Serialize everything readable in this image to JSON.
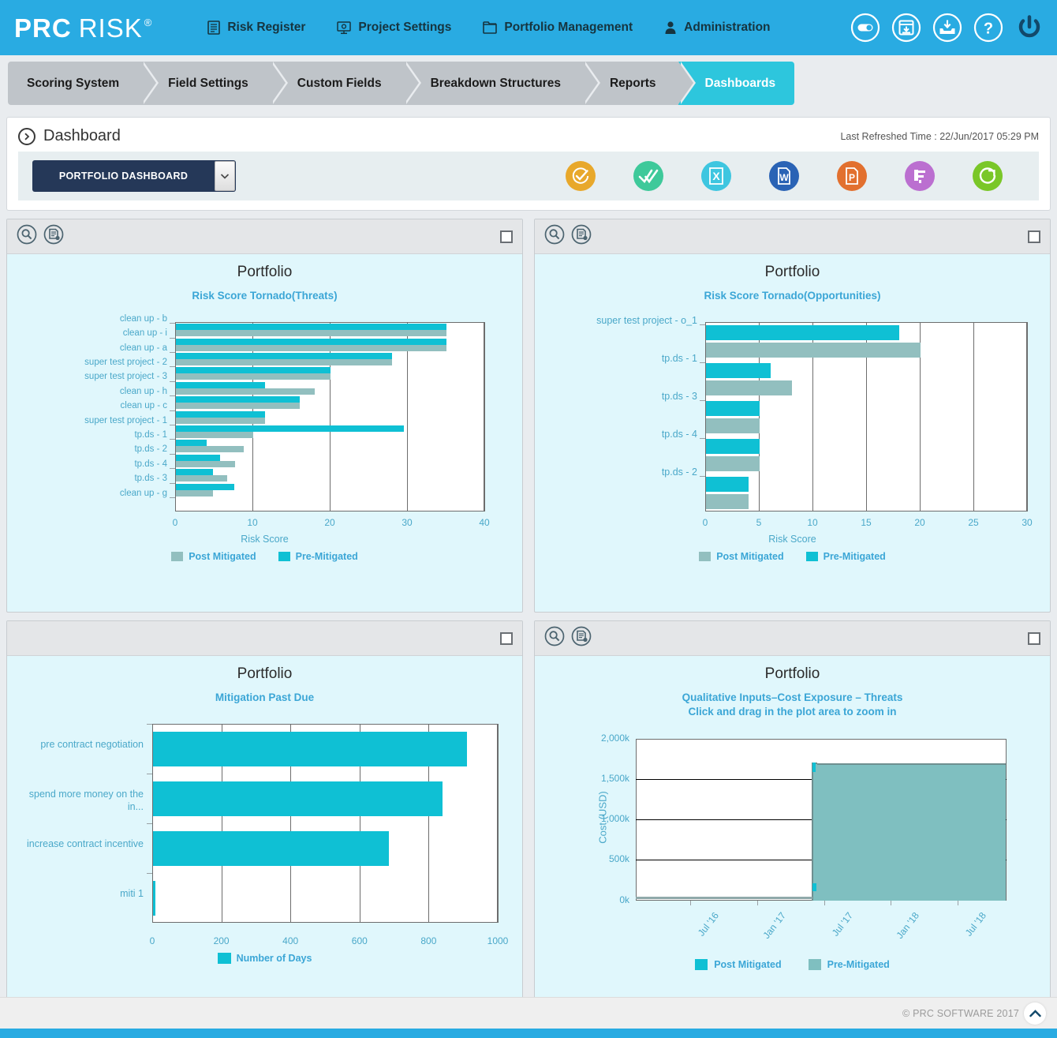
{
  "brand": {
    "part1": "PRC",
    "part2": "RISK",
    "registered": "®"
  },
  "nav": [
    {
      "label": "Risk Register",
      "icon": "document-list-icon"
    },
    {
      "label": "Project Settings",
      "icon": "project-settings-icon"
    },
    {
      "label": "Portfolio Management",
      "icon": "folder-icon"
    },
    {
      "label": "Administration",
      "icon": "user-icon"
    }
  ],
  "header_icons": [
    {
      "name": "toggle-icon",
      "title": "Toggle"
    },
    {
      "name": "calendar-window-icon",
      "title": "Window"
    },
    {
      "name": "inbox-download-icon",
      "title": "Download"
    },
    {
      "name": "help-icon",
      "title": "Help"
    },
    {
      "name": "power-icon",
      "title": "Log out"
    }
  ],
  "tabs": [
    {
      "label": "Scoring System",
      "active": false
    },
    {
      "label": "Field Settings",
      "active": false
    },
    {
      "label": "Custom Fields",
      "active": false
    },
    {
      "label": "Breakdown Structures",
      "active": false
    },
    {
      "label": "Reports",
      "active": false
    },
    {
      "label": "Dashboards",
      "active": true
    }
  ],
  "dashboard": {
    "title": "Dashboard",
    "refreshed_label": "Last Refreshed Time : 22/Jun/2017 05:29 PM",
    "selected_dashboard": "PORTFOLIO DASHBOARD",
    "export_icons": [
      {
        "name": "approve-check-icon",
        "color": "#e8a82b"
      },
      {
        "name": "double-check-icon",
        "color": "#3ec99a"
      },
      {
        "name": "excel-export-icon",
        "color": "#3ec6e0"
      },
      {
        "name": "word-export-icon",
        "color": "#2a63b5"
      },
      {
        "name": "powerpoint-export-icon",
        "color": "#e2702f"
      },
      {
        "name": "ms-project-export-icon",
        "color": "#bb6fd0"
      },
      {
        "name": "refresh-icon",
        "color": "#7ac728"
      }
    ]
  },
  "colors": {
    "accent": "#29abe2",
    "pre_mitigated": "#0fc0d4",
    "post_mitigated": "#92bfbf",
    "panel_bg": "#e0f7fc",
    "title": "#3ba6d6"
  },
  "panels": [
    {
      "name": "risk-score-tornado-threats",
      "has_tools": true,
      "tools": [
        "zoom-icon",
        "print-report-icon"
      ],
      "checkbox": false
    },
    {
      "name": "risk-score-tornado-opportunities",
      "has_tools": true,
      "tools": [
        "zoom-icon",
        "print-report-icon"
      ],
      "checkbox": false
    },
    {
      "name": "mitigation-past-due",
      "has_tools": false,
      "tools": [],
      "checkbox": false
    },
    {
      "name": "cost-exposure-threats",
      "has_tools": true,
      "tools": [
        "zoom-icon",
        "print-report-icon"
      ],
      "checkbox": false
    }
  ],
  "chart_data": [
    {
      "type": "bar",
      "orientation": "horizontal",
      "title": "Portfolio",
      "subtitle": "Risk Score Tornado(Threats)",
      "xlabel": "Risk Score",
      "ylabel": "",
      "xlim": [
        0,
        40
      ],
      "xticks": [
        0,
        10,
        20,
        30,
        40
      ],
      "grid": true,
      "legend": "bottom",
      "categories": [
        "clean up - b",
        "clean up - i",
        "clean up - a",
        "super test project - 2",
        "super test project - 3",
        "clean up - h",
        "clean up - c",
        "super test project - 1",
        "tp.ds - 1",
        "tp.ds - 2",
        "tp.ds - 4",
        "tp.ds - 3",
        "clean up - g"
      ],
      "series": [
        {
          "name": "Pre-Mitigated",
          "color": "#0fc0d4",
          "values": [
            35,
            35,
            28,
            20,
            11.5,
            16,
            11.5,
            29.5,
            4,
            5.7,
            4.8,
            7.6,
            0
          ]
        },
        {
          "name": "Post Mitigated",
          "color": "#92bfbf",
          "values": [
            35,
            35,
            28,
            20,
            18,
            16,
            11.5,
            10,
            8.8,
            7.7,
            6.6,
            4.8,
            0
          ]
        }
      ]
    },
    {
      "type": "bar",
      "orientation": "horizontal",
      "title": "Portfolio",
      "subtitle": "Risk Score Tornado(Opportunities)",
      "xlabel": "Risk Score",
      "ylabel": "",
      "xlim": [
        0,
        30
      ],
      "xticks": [
        0,
        5,
        10,
        15,
        20,
        25,
        30
      ],
      "grid": true,
      "legend": "bottom",
      "categories": [
        "super test project - o_1",
        "tp.ds - 1",
        "tp.ds - 3",
        "tp.ds - 4",
        "tp.ds - 2"
      ],
      "series": [
        {
          "name": "Pre-Mitigated",
          "color": "#0fc0d4",
          "values": [
            18,
            6,
            5,
            5,
            4
          ]
        },
        {
          "name": "Post Mitigated",
          "color": "#92bfbf",
          "values": [
            20,
            8,
            5,
            5,
            4
          ]
        }
      ]
    },
    {
      "type": "bar",
      "orientation": "horizontal",
      "title": "Portfolio",
      "subtitle": "Mitigation Past Due",
      "xlabel": "Number of Days",
      "ylabel": "",
      "xlim": [
        0,
        1000
      ],
      "xticks": [
        0,
        200,
        400,
        600,
        800,
        1000
      ],
      "grid": true,
      "legend": "bottom",
      "categories": [
        "pre contract negotiation",
        "spend more money on the in...",
        "increase contract incentive",
        "miti 1"
      ],
      "series": [
        {
          "name": "Number of Days",
          "color": "#0fc0d4",
          "values": [
            908,
            838,
            682,
            5
          ]
        }
      ]
    },
    {
      "type": "area",
      "title": "Portfolio",
      "subtitle_line1": "Qualitative Inputs–Cost Exposure – Threats",
      "subtitle_line2": "Click and drag in the plot area to zoom in",
      "xlabel": "",
      "ylabel": "Cost (USD)",
      "ylim": [
        0,
        2000
      ],
      "yticks": [
        0,
        500,
        1000,
        1500,
        2000
      ],
      "ytick_labels": [
        "0k",
        "500k",
        "1,000k",
        "1,500k",
        "2,000k"
      ],
      "xtick_labels": [
        "Jul '16",
        "Jan '17",
        "Jul '17",
        "Jan '18",
        "Jul '18"
      ],
      "grid": true,
      "legend": "bottom",
      "series": [
        {
          "name": "Post Mitigated",
          "color": "#0fc0d4",
          "x": [
            "Apr '16",
            "Jul '17",
            "Jul '17",
            "Aug '18"
          ],
          "values": [
            0,
            0,
            1800,
            1700
          ]
        },
        {
          "name": "Pre-Mitigated",
          "color": "#7fbfc0",
          "x": [
            "Apr '16",
            "Jul '17",
            "Jul '17",
            "Aug '18"
          ],
          "values": [
            0,
            0,
            1700,
            1690
          ]
        }
      ]
    }
  ],
  "footer": {
    "copyright": "© PRC SOFTWARE 2017",
    "scroll_top_icon": "chevron-up-icon"
  }
}
